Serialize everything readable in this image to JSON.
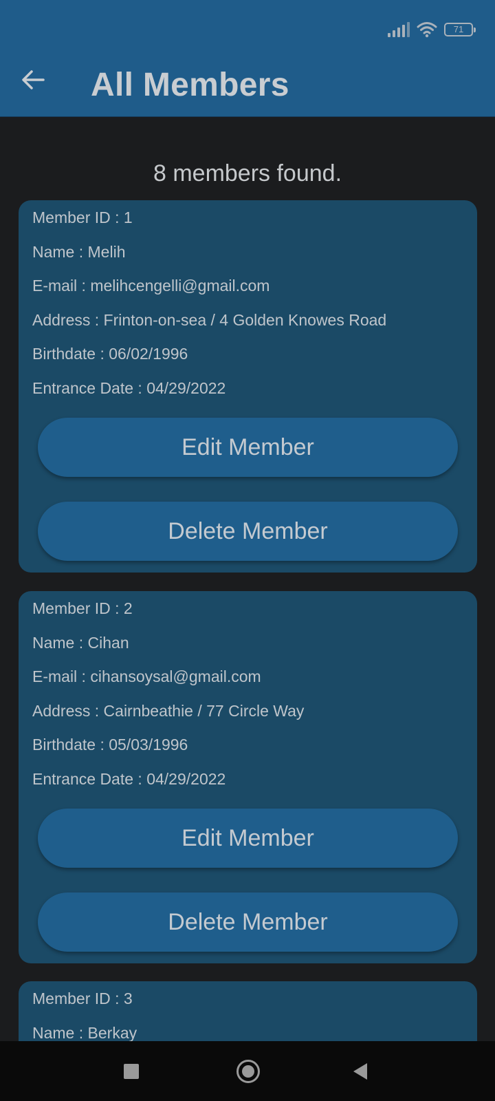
{
  "status": {
    "battery": "71"
  },
  "appbar": {
    "title": "All Members"
  },
  "summary": {
    "text": "8 members found."
  },
  "members": [
    {
      "id_line": "Member ID : 1",
      "name_line": "Name : Melih",
      "email_line": "E-mail : melihcengelli@gmail.com",
      "address_line": "Address : Frinton-on-sea / 4 Golden Knowes Road",
      "birthdate_line": "Birthdate : 06/02/1996",
      "entrance_line": "Entrance Date : 04/29/2022",
      "edit_label": "Edit Member",
      "delete_label": "Delete Member"
    },
    {
      "id_line": "Member ID : 2",
      "name_line": "Name : Cihan",
      "email_line": "E-mail : cihansoysal@gmail.com",
      "address_line": "Address : Cairnbeathie / 77 Circle Way",
      "birthdate_line": "Birthdate : 05/03/1996",
      "entrance_line": "Entrance Date : 04/29/2022",
      "edit_label": "Edit Member",
      "delete_label": "Delete Member"
    },
    {
      "id_line": "Member ID : 3",
      "name_line": "Name : Berkay"
    }
  ],
  "colors": {
    "appbar": "#1f5c8a",
    "background": "#1b1c1e",
    "card": "#1b4a66",
    "button": "#1f5e8c"
  }
}
